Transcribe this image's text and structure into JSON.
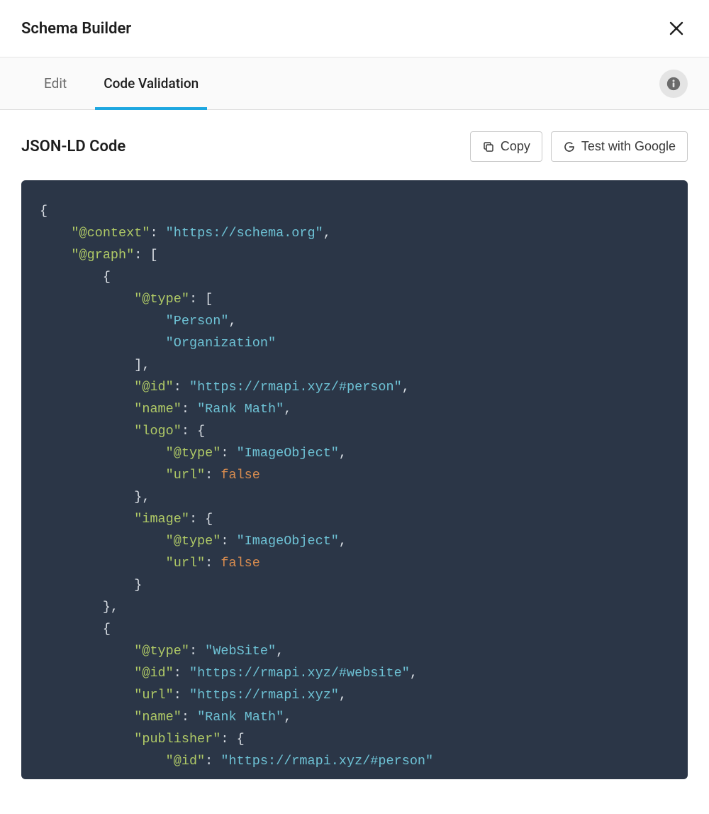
{
  "header": {
    "title": "Schema Builder"
  },
  "tabs": {
    "edit": "Edit",
    "code_validation": "Code Validation"
  },
  "section": {
    "title": "JSON-LD Code"
  },
  "actions": {
    "copy": "Copy",
    "test_google": "Test with Google"
  },
  "code_tokens": [
    {
      "indent": 0,
      "parts": [
        {
          "t": "punct",
          "v": "{"
        }
      ]
    },
    {
      "indent": 2,
      "parts": [
        {
          "t": "key",
          "v": "\"@context\""
        },
        {
          "t": "punct",
          "v": ": "
        },
        {
          "t": "str",
          "v": "\"https://schema.org\""
        },
        {
          "t": "punct",
          "v": ","
        }
      ]
    },
    {
      "indent": 2,
      "parts": [
        {
          "t": "key",
          "v": "\"@graph\""
        },
        {
          "t": "punct",
          "v": ": ["
        }
      ]
    },
    {
      "indent": 4,
      "parts": [
        {
          "t": "punct",
          "v": "{"
        }
      ]
    },
    {
      "indent": 6,
      "parts": [
        {
          "t": "key",
          "v": "\"@type\""
        },
        {
          "t": "punct",
          "v": ": ["
        }
      ]
    },
    {
      "indent": 8,
      "parts": [
        {
          "t": "str",
          "v": "\"Person\""
        },
        {
          "t": "punct",
          "v": ","
        }
      ]
    },
    {
      "indent": 8,
      "parts": [
        {
          "t": "str",
          "v": "\"Organization\""
        }
      ]
    },
    {
      "indent": 6,
      "parts": [
        {
          "t": "punct",
          "v": "],"
        }
      ]
    },
    {
      "indent": 6,
      "parts": [
        {
          "t": "key",
          "v": "\"@id\""
        },
        {
          "t": "punct",
          "v": ": "
        },
        {
          "t": "str",
          "v": "\"https://rmapi.xyz/#person\""
        },
        {
          "t": "punct",
          "v": ","
        }
      ]
    },
    {
      "indent": 6,
      "parts": [
        {
          "t": "key",
          "v": "\"name\""
        },
        {
          "t": "punct",
          "v": ": "
        },
        {
          "t": "str",
          "v": "\"Rank Math\""
        },
        {
          "t": "punct",
          "v": ","
        }
      ]
    },
    {
      "indent": 6,
      "parts": [
        {
          "t": "key",
          "v": "\"logo\""
        },
        {
          "t": "punct",
          "v": ": {"
        }
      ]
    },
    {
      "indent": 8,
      "parts": [
        {
          "t": "key",
          "v": "\"@type\""
        },
        {
          "t": "punct",
          "v": ": "
        },
        {
          "t": "str",
          "v": "\"ImageObject\""
        },
        {
          "t": "punct",
          "v": ","
        }
      ]
    },
    {
      "indent": 8,
      "parts": [
        {
          "t": "key",
          "v": "\"url\""
        },
        {
          "t": "punct",
          "v": ": "
        },
        {
          "t": "bool",
          "v": "false"
        }
      ]
    },
    {
      "indent": 6,
      "parts": [
        {
          "t": "punct",
          "v": "},"
        }
      ]
    },
    {
      "indent": 6,
      "parts": [
        {
          "t": "key",
          "v": "\"image\""
        },
        {
          "t": "punct",
          "v": ": {"
        }
      ]
    },
    {
      "indent": 8,
      "parts": [
        {
          "t": "key",
          "v": "\"@type\""
        },
        {
          "t": "punct",
          "v": ": "
        },
        {
          "t": "str",
          "v": "\"ImageObject\""
        },
        {
          "t": "punct",
          "v": ","
        }
      ]
    },
    {
      "indent": 8,
      "parts": [
        {
          "t": "key",
          "v": "\"url\""
        },
        {
          "t": "punct",
          "v": ": "
        },
        {
          "t": "bool",
          "v": "false"
        }
      ]
    },
    {
      "indent": 6,
      "parts": [
        {
          "t": "punct",
          "v": "}"
        }
      ]
    },
    {
      "indent": 4,
      "parts": [
        {
          "t": "punct",
          "v": "},"
        }
      ]
    },
    {
      "indent": 4,
      "parts": [
        {
          "t": "punct",
          "v": "{"
        }
      ]
    },
    {
      "indent": 6,
      "parts": [
        {
          "t": "key",
          "v": "\"@type\""
        },
        {
          "t": "punct",
          "v": ": "
        },
        {
          "t": "str",
          "v": "\"WebSite\""
        },
        {
          "t": "punct",
          "v": ","
        }
      ]
    },
    {
      "indent": 6,
      "parts": [
        {
          "t": "key",
          "v": "\"@id\""
        },
        {
          "t": "punct",
          "v": ": "
        },
        {
          "t": "str",
          "v": "\"https://rmapi.xyz/#website\""
        },
        {
          "t": "punct",
          "v": ","
        }
      ]
    },
    {
      "indent": 6,
      "parts": [
        {
          "t": "key",
          "v": "\"url\""
        },
        {
          "t": "punct",
          "v": ": "
        },
        {
          "t": "str",
          "v": "\"https://rmapi.xyz\""
        },
        {
          "t": "punct",
          "v": ","
        }
      ]
    },
    {
      "indent": 6,
      "parts": [
        {
          "t": "key",
          "v": "\"name\""
        },
        {
          "t": "punct",
          "v": ": "
        },
        {
          "t": "str",
          "v": "\"Rank Math\""
        },
        {
          "t": "punct",
          "v": ","
        }
      ]
    },
    {
      "indent": 6,
      "parts": [
        {
          "t": "key",
          "v": "\"publisher\""
        },
        {
          "t": "punct",
          "v": ": {"
        }
      ]
    },
    {
      "indent": 8,
      "parts": [
        {
          "t": "key",
          "v": "\"@id\""
        },
        {
          "t": "punct",
          "v": ": "
        },
        {
          "t": "str",
          "v": "\"https://rmapi.xyz/#person\""
        }
      ]
    }
  ]
}
